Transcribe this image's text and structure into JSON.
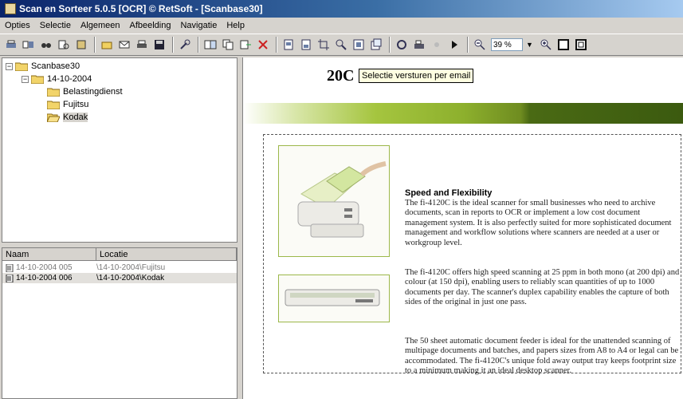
{
  "window": {
    "title": "Scan en Sorteer 5.0.5 [OCR] © RetSoft  -  [Scanbase30]"
  },
  "menu": [
    "Opties",
    "Selectie",
    "Algemeen",
    "Afbeelding",
    "Navigatie",
    "Help"
  ],
  "toolbar": {
    "zoom_value": "39 %",
    "icons": [
      "scan-icon",
      "scan-batch-icon",
      "find-icon",
      "search-text-icon",
      "archive-icon",
      "new-folder-icon",
      "email-icon",
      "print-icon",
      "save-icon",
      "tools-icon",
      "ocr-icon",
      "copy-icon",
      "export-icon",
      "delete-icon",
      "page-icon",
      "page-select-icon",
      "crop-icon",
      "zoom-area-icon",
      "fit-icon",
      "rotate-icon",
      "refresh-icon",
      "scanner-icon",
      "brightness-icon",
      "play-icon",
      "zoom-out-icon",
      "zoom-in-icon",
      "single-page-icon",
      "two-page-icon"
    ]
  },
  "tree": [
    {
      "label": "Scanbase30",
      "indent": 0,
      "toggle": "−"
    },
    {
      "label": "14-10-2004",
      "indent": 1,
      "toggle": "−"
    },
    {
      "label": "Belastingdienst",
      "indent": 2,
      "toggle": ""
    },
    {
      "label": "Fujitsu",
      "indent": 2,
      "toggle": ""
    },
    {
      "label": "Kodak",
      "indent": 2,
      "toggle": "",
      "selected": true
    }
  ],
  "filelist": {
    "columns": [
      "Naam",
      "Locatie"
    ],
    "rows": [
      {
        "naam": "14-10-2004 005",
        "locatie": "\\14-10-2004\\Fujitsu",
        "dim": true
      },
      {
        "naam": "14-10-2004 006",
        "locatie": "\\14-10-2004\\Kodak",
        "selected": true
      }
    ]
  },
  "viewer": {
    "heading": "20C",
    "tooltip": "Selectie versturen per email",
    "section_title": "Speed and Flexibility",
    "paragraphs": [
      "The fi-4120C is the ideal scanner for small businesses who need to archive documents, scan in reports to OCR or implement a low cost document management system. It is also perfectly suited for more sophisticated document management and workflow solutions where scanners are needed at a user or workgroup level.",
      "The fi-4120C offers high speed scanning at 25 ppm in both mono (at 200 dpi) and colour (at 150 dpi), enabling users to reliably scan quantities of up to 1000 documents per day. The scanner's duplex capability enables the capture of both sides of the original in just one pass.",
      "The 50 sheet automatic document feeder is ideal for the unattended scanning of multipage documents and batches, and papers sizes from A8 to A4 or legal can be accommodated. The fi-4120C's unique fold away output tray keeps footprint size to a minimum making it an ideal desktop scanner."
    ]
  }
}
